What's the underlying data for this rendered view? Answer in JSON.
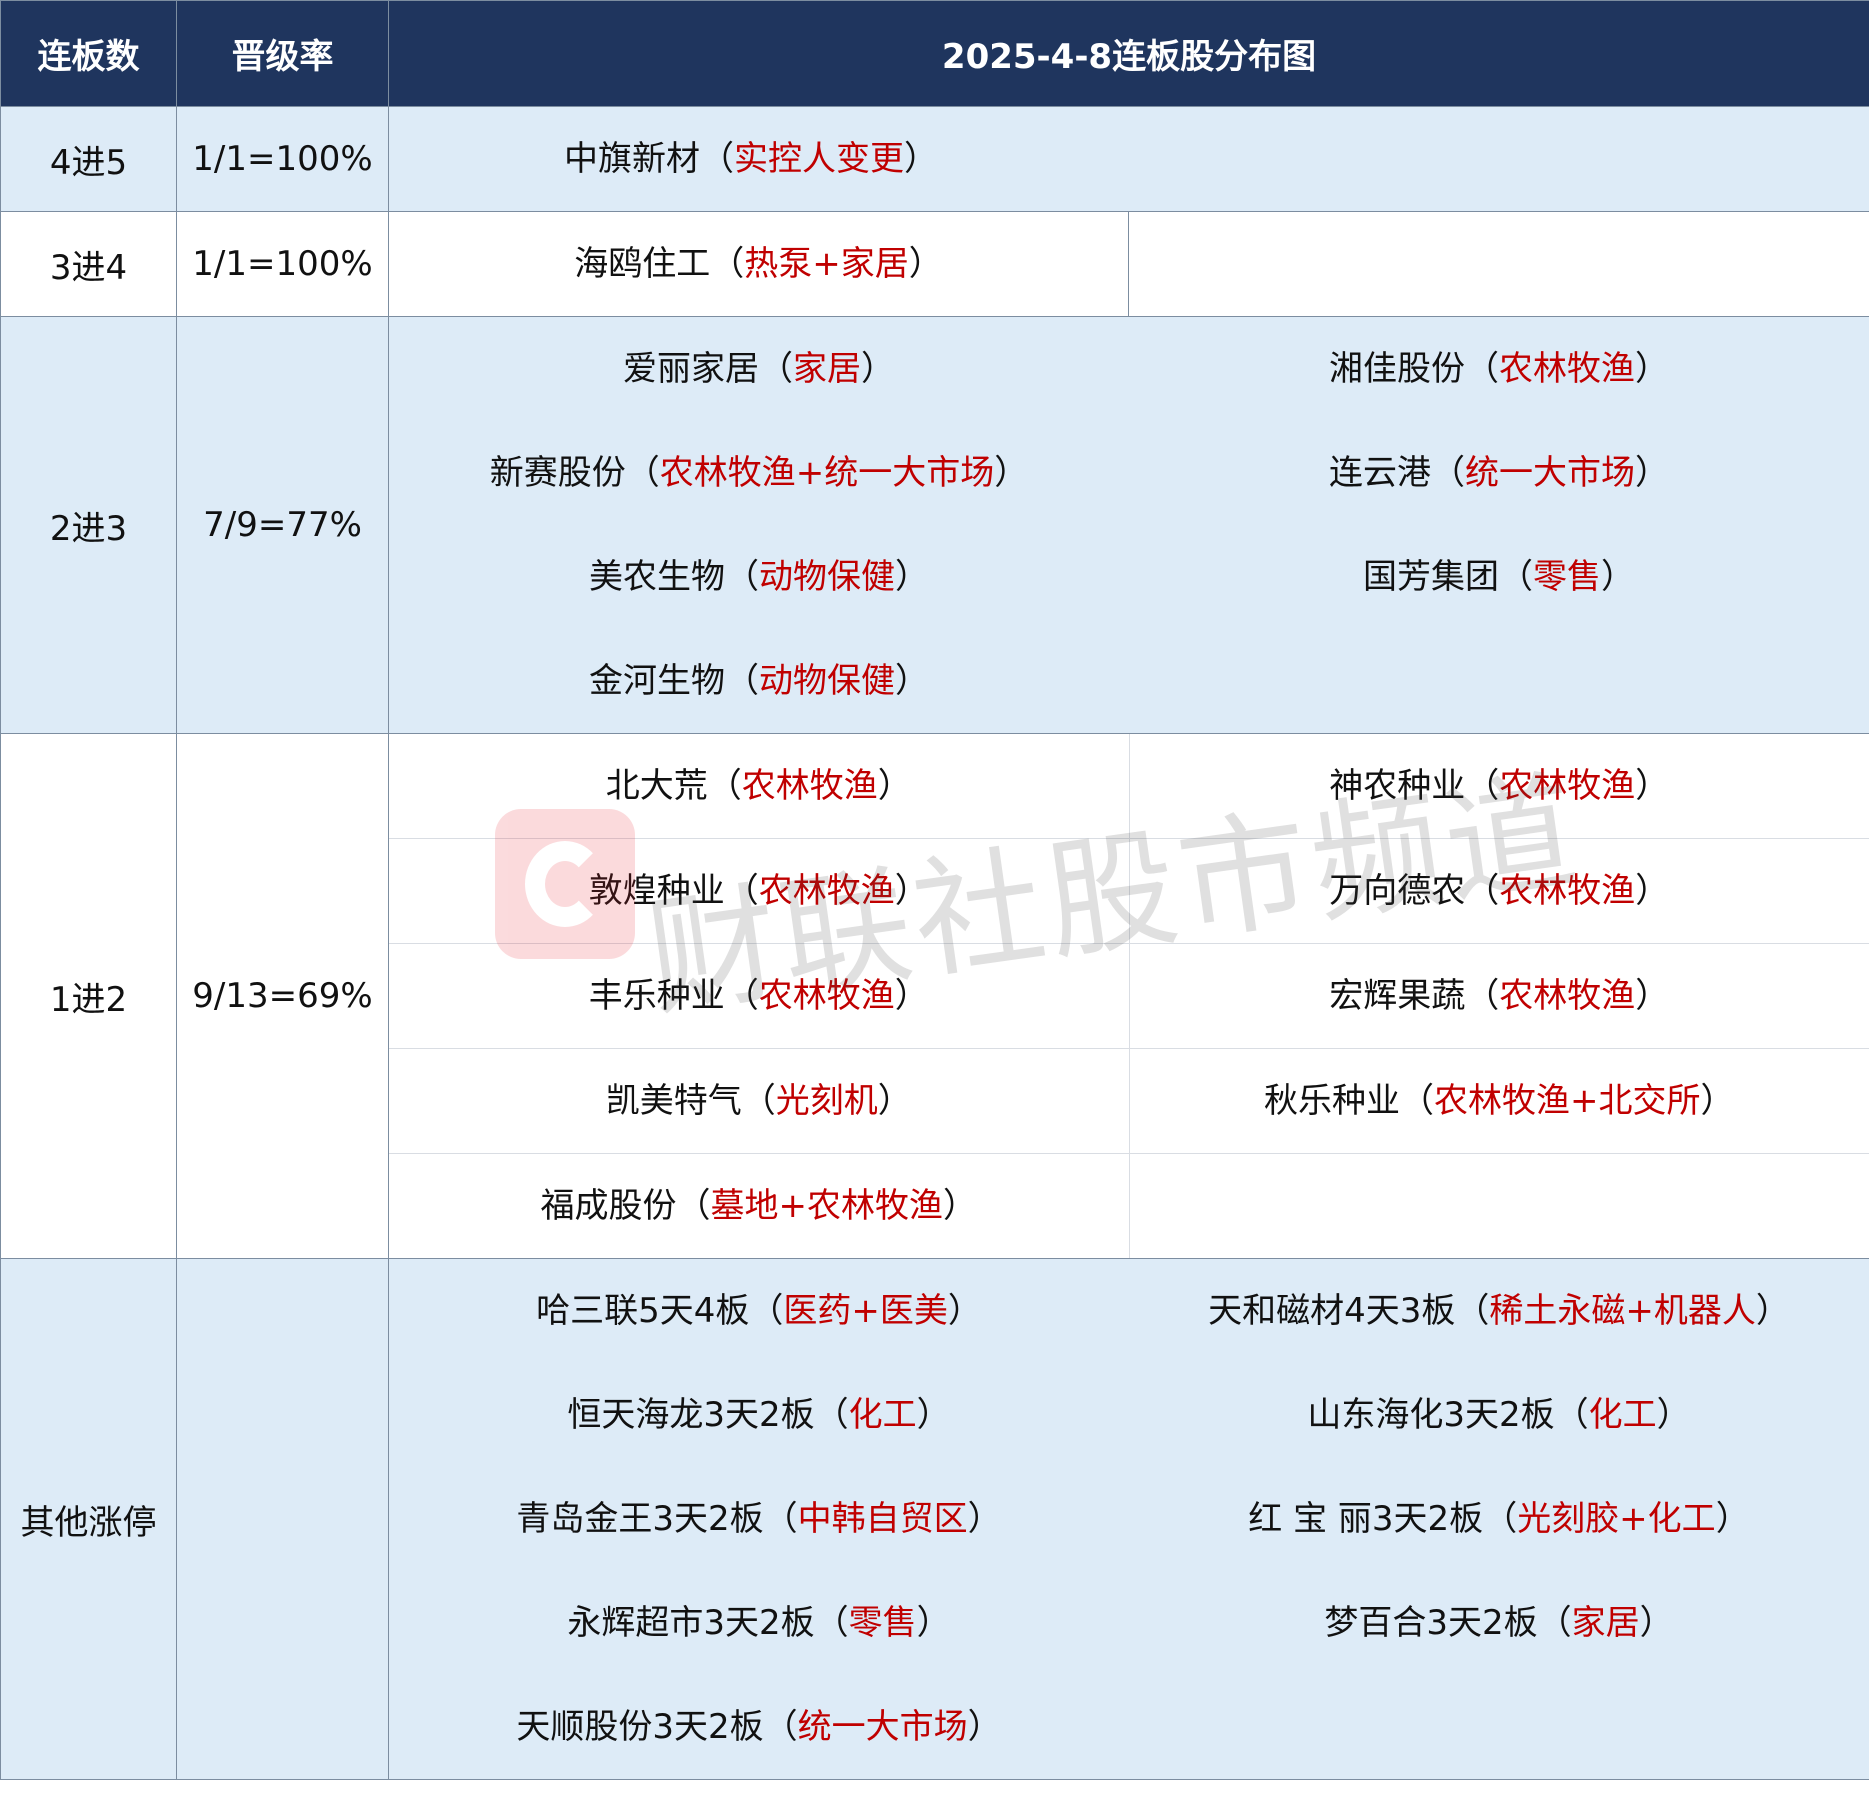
{
  "header": {
    "col1": "连板数",
    "col2": "晋级率",
    "title": "2025-4-8连板股分布图"
  },
  "rows": {
    "r45": {
      "level": "4进5",
      "rate": "1/1=100%",
      "items": [
        {
          "name": "中旗新材",
          "tag": "实控人变更"
        }
      ]
    },
    "r34": {
      "level": "3进4",
      "rate": "1/1=100%",
      "items": [
        {
          "name": "海鸥住工",
          "tag": "热泵+家居"
        }
      ]
    },
    "r23": {
      "level": "2进3",
      "rate": "7/9=77%",
      "items": [
        {
          "name": "爱丽家居",
          "tag": "家居"
        },
        {
          "name": "湘佳股份",
          "tag": "农林牧渔"
        },
        {
          "name": "新赛股份",
          "tag": "农林牧渔+统一大市场"
        },
        {
          "name": "连云港",
          "tag": "统一大市场"
        },
        {
          "name": "美农生物",
          "tag": "动物保健"
        },
        {
          "name": "国芳集团",
          "tag": "零售"
        },
        {
          "name": "金河生物",
          "tag": "动物保健"
        }
      ]
    },
    "r12": {
      "level": "1进2",
      "rate": "9/13=69%",
      "items": [
        {
          "name": "北大荒",
          "tag": "农林牧渔"
        },
        {
          "name": "神农种业",
          "tag": "农林牧渔"
        },
        {
          "name": "敦煌种业",
          "tag": "农林牧渔"
        },
        {
          "name": "万向德农",
          "tag": "农林牧渔"
        },
        {
          "name": "丰乐种业",
          "tag": "农林牧渔"
        },
        {
          "name": "宏辉果蔬",
          "tag": "农林牧渔"
        },
        {
          "name": "凯美特气",
          "tag": "光刻机"
        },
        {
          "name": "秋乐种业",
          "tag": "农林牧渔+北交所"
        },
        {
          "name": "福成股份",
          "tag": "墓地+农林牧渔"
        }
      ]
    },
    "other": {
      "level": "其他涨停",
      "rate": "",
      "items": [
        {
          "name": "哈三联5天4板",
          "tag": "医药+医美"
        },
        {
          "name": "天和磁材4天3板",
          "tag": "稀土永磁+机器人"
        },
        {
          "name": "恒天海龙3天2板",
          "tag": "化工"
        },
        {
          "name": "山东海化3天2板",
          "tag": "化工"
        },
        {
          "name": "青岛金王3天2板",
          "tag": "中韩自贸区"
        },
        {
          "name": "红 宝 丽3天2板",
          "tag": "光刻胶+化工"
        },
        {
          "name": "永辉超市3天2板",
          "tag": "零售"
        },
        {
          "name": "梦百合3天2板",
          "tag": "家居"
        },
        {
          "name": "天顺股份3天2板",
          "tag": "统一大市场"
        }
      ]
    }
  },
  "brackets": {
    "open": "（",
    "close": "）"
  },
  "watermark": {
    "text": "财联社股市频道",
    "logo_icon": "cls-logo-icon",
    "logo_color": "#e8202a"
  },
  "colors": {
    "header_bg": "#1f355e",
    "row_blue": "#ddebf7",
    "tag_red": "#c00000"
  }
}
